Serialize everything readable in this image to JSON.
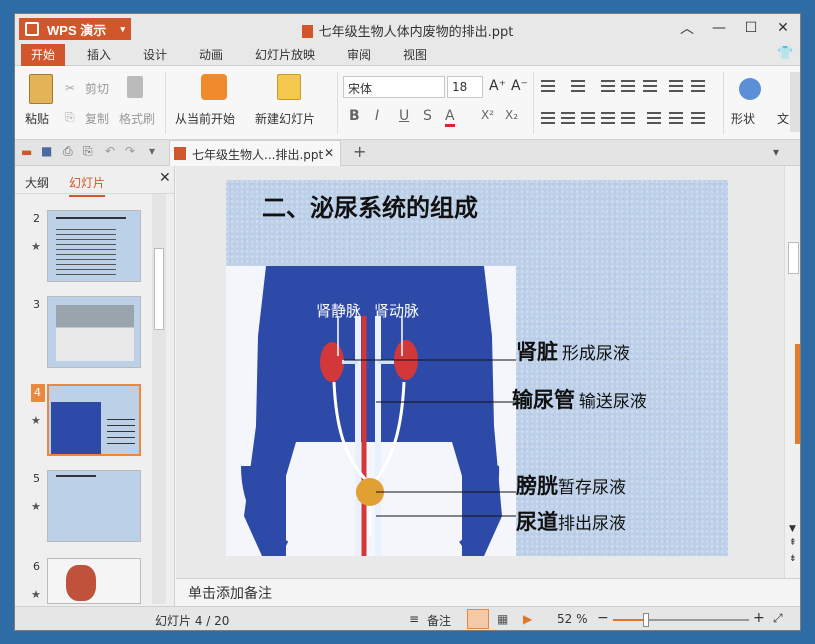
{
  "app": {
    "name": "WPS 演示",
    "window_title": "七年级生物人体内废物的排出.ppt"
  },
  "menu_tabs": [
    "开始",
    "插入",
    "设计",
    "动画",
    "幻灯片放映",
    "审阅",
    "视图"
  ],
  "ribbon": {
    "paste": "粘贴",
    "cut": "剪切",
    "copy": "复制",
    "format_painter": "格式刷",
    "from_current": "从当前开始",
    "new_slide": "新建幻灯片",
    "font_name": "宋体",
    "font_size": "18",
    "bold": "B",
    "italic": "I",
    "underline": "U",
    "strike": "S",
    "font_color": "A",
    "superscript": "X²",
    "subscript": "X₂",
    "grow": "A⁺",
    "shrink": "A⁻",
    "shapes": "形状",
    "more": "文"
  },
  "doc_tab": {
    "name": "七年级生物人...排出.ppt"
  },
  "left_panel": {
    "tab_outline": "大纲",
    "tab_slides": "幻灯片"
  },
  "thumbs": [
    {
      "num": "2"
    },
    {
      "num": "3"
    },
    {
      "num": "4"
    },
    {
      "num": "5"
    },
    {
      "num": "6"
    }
  ],
  "slide": {
    "title": "二、泌尿系统的组成",
    "vein": "肾静脉",
    "artery": "肾动脉",
    "rows": [
      {
        "organ": "肾脏",
        "desc": "形成尿液"
      },
      {
        "organ": "输尿管",
        "desc": "输送尿液"
      },
      {
        "organ": "膀胱",
        "desc": "暂存尿液"
      },
      {
        "organ": "尿道",
        "desc": "排出尿液"
      }
    ]
  },
  "notes_placeholder": "单击添加备注",
  "status": {
    "slide_counter": "幻灯片 4 / 20",
    "notes": "备注",
    "zoom": "52 %"
  },
  "colors": {
    "accent": "#d2562b",
    "slide_bg": "#bcd0e8",
    "body_blue": "#2e4aa8"
  }
}
